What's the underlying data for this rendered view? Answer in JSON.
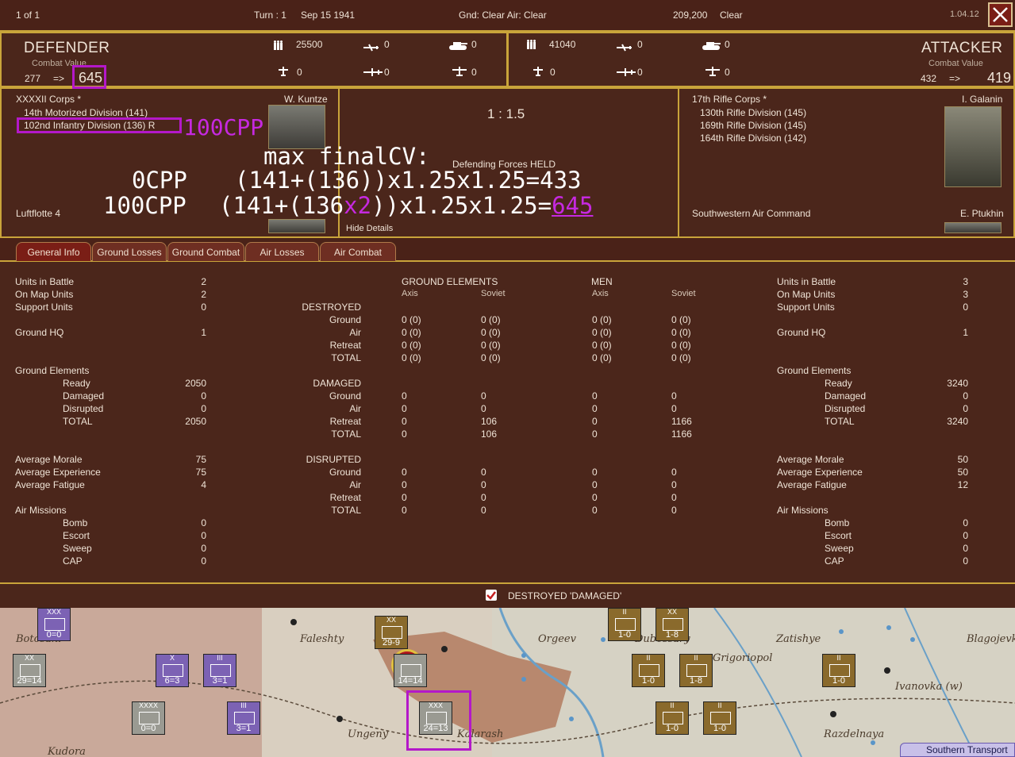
{
  "topbar": {
    "page": "1 of 1",
    "turn": "Turn : 1",
    "date": "Sep 15 1941",
    "weather": "Gnd: Clear  Air: Clear",
    "coords": "209,200",
    "terrain": "Clear",
    "version": "1.04.12",
    "close_icon": "close-x-icon"
  },
  "defender": {
    "title": "DEFENDER",
    "cv_label": "Combat Value",
    "cv_base": "277",
    "arrow": "=>",
    "cv_final": "645",
    "men": "25500",
    "fighters": "0",
    "tanks": "0",
    "bombers": "0",
    "transports": "0",
    "recon": "0",
    "corps": "XXXXII Corps *",
    "commander": "W. Kuntze",
    "units": [
      "14th Motorized Division (141)",
      "102nd Infantry Division (136)  R"
    ],
    "air": "Luftflotte 4"
  },
  "attacker": {
    "title": "ATTACKER",
    "cv_label": "Combat Value",
    "cv_base": "432",
    "arrow": "=>",
    "cv_final": "419",
    "men": "41040",
    "fighters": "0",
    "tanks": "0",
    "bombers": "0",
    "transports": "0",
    "recon": "0",
    "corps": "17th Rifle Corps *",
    "commander": "I. Galanin",
    "units": [
      "130th Rifle Division (145)",
      "169th Rifle Division (145)",
      "164th Rifle Division (142)"
    ],
    "air": "Southwestern Air Command",
    "air_commander": "E. Ptukhin"
  },
  "center": {
    "odds": "1 : 1.5",
    "result": "Defending Forces HELD",
    "hide": "Hide Details"
  },
  "overlay": {
    "cpp_label": "100CPP",
    "max_title": "max finalCV:",
    "row1_label": "0CPP",
    "row1_formula": "(141+(136))x1.25x1.25=433",
    "row2_label": "100CPP",
    "row2_a": "(141+(",
    "row2_b": "136",
    "row2_c": "x2",
    "row2_d": "))x1.25x1.25=",
    "row2_e": "645"
  },
  "tabs": [
    "General Info",
    "Ground Losses",
    "Ground Combat",
    "Air Losses",
    "Air Combat"
  ],
  "left_stats": [
    [
      "Units in Battle",
      "2"
    ],
    [
      "On Map Units",
      "2"
    ],
    [
      "Support Units",
      "0"
    ],
    [
      "",
      ""
    ],
    [
      "Ground HQ",
      "1"
    ],
    [
      "",
      ""
    ],
    [
      "",
      ""
    ],
    [
      "Ground Elements",
      ""
    ],
    [
      "  Ready",
      "2050"
    ],
    [
      "  Damaged",
      "0"
    ],
    [
      "  Disrupted",
      "0"
    ],
    [
      "  TOTAL",
      "2050"
    ],
    [
      "",
      ""
    ],
    [
      "",
      ""
    ],
    [
      "Average Morale",
      "75"
    ],
    [
      "Average Experience",
      "75"
    ],
    [
      "Average Fatigue",
      "4"
    ],
    [
      "",
      ""
    ],
    [
      "Air Missions",
      ""
    ],
    [
      "  Bomb",
      "0"
    ],
    [
      "  Escort",
      "0"
    ],
    [
      "  Sweep",
      "0"
    ],
    [
      "  CAP",
      "0"
    ]
  ],
  "right_stats": [
    [
      "Units in Battle",
      "3"
    ],
    [
      "On Map Units",
      "3"
    ],
    [
      "Support Units",
      "0"
    ],
    [
      "",
      ""
    ],
    [
      "Ground HQ",
      "1"
    ],
    [
      "",
      ""
    ],
    [
      "",
      ""
    ],
    [
      "Ground Elements",
      ""
    ],
    [
      "  Ready",
      "3240"
    ],
    [
      "  Damaged",
      "0"
    ],
    [
      "  Disrupted",
      "0"
    ],
    [
      "  TOTAL",
      "3240"
    ],
    [
      "",
      ""
    ],
    [
      "",
      ""
    ],
    [
      "Average Morale",
      "50"
    ],
    [
      "Average Experience",
      "50"
    ],
    [
      "Average Fatigue",
      "12"
    ],
    [
      "",
      ""
    ],
    [
      "Air Missions",
      ""
    ],
    [
      "  Bomb",
      "0"
    ],
    [
      "  Escort",
      "0"
    ],
    [
      "  Sweep",
      "0"
    ],
    [
      "  CAP",
      "0"
    ]
  ],
  "losses": {
    "hdr_ge": "GROUND ELEMENTS",
    "hdr_men": "MEN",
    "axis": "Axis",
    "soviet": "Soviet",
    "rows": [
      [
        "DESTROYED",
        "",
        "",
        "",
        "",
        ""
      ],
      [
        "Ground",
        "0  (0)",
        "0  (0)",
        "0  (0)",
        "0  (0)",
        ""
      ],
      [
        "Air",
        "0  (0)",
        "0  (0)",
        "0  (0)",
        "0  (0)",
        ""
      ],
      [
        "Retreat",
        "0  (0)",
        "0  (0)",
        "0  (0)",
        "0  (0)",
        ""
      ],
      [
        "TOTAL",
        "0  (0)",
        "0  (0)",
        "0  (0)",
        "0  (0)",
        ""
      ],
      [
        "",
        "",
        "",
        "",
        "",
        ""
      ],
      [
        "DAMAGED",
        "",
        "",
        "",
        "",
        ""
      ],
      [
        "Ground",
        "0",
        "0",
        "0",
        "0",
        ""
      ],
      [
        "Air",
        "0",
        "0",
        "0",
        "0",
        ""
      ],
      [
        "Retreat",
        "0",
        "106",
        "0",
        "1166",
        ""
      ],
      [
        "TOTAL",
        "0",
        "106",
        "0",
        "1166",
        ""
      ],
      [
        "",
        "",
        "",
        "",
        "",
        ""
      ],
      [
        "DISRUPTED",
        "",
        "",
        "",
        "",
        ""
      ],
      [
        "Ground",
        "0",
        "0",
        "0",
        "0",
        ""
      ],
      [
        "Air",
        "0",
        "0",
        "0",
        "0",
        ""
      ],
      [
        "Retreat",
        "0",
        "0",
        "0",
        "0",
        ""
      ],
      [
        "TOTAL",
        "0",
        "0",
        "0",
        "0",
        ""
      ]
    ]
  },
  "footer": {
    "checkbox_label": "DESTROYED 'DAMAGED'",
    "checked": true
  },
  "map": {
    "places": [
      "Botosani",
      "Faleshty",
      "Orgeev",
      "Zatishye",
      "Blagojevka",
      "Grigoriopol",
      "Ivanovka (w)",
      "Ungeny",
      "Kalarash",
      "Razdelnaya",
      "Dubossary",
      "Kudora"
    ],
    "transport_btn": "Southern Transport",
    "units": [
      {
        "top": "XXX",
        "lbl": "0=0",
        "color": "#7c62b4"
      },
      {
        "top": "XX",
        "lbl": "29=14",
        "color": "#9a9a92"
      },
      {
        "top": "X",
        "lbl": "6=3",
        "color": "#7c62b4"
      },
      {
        "top": "III",
        "lbl": "3=1",
        "color": "#7c62b4"
      },
      {
        "top": "XXXX",
        "lbl": "0=0",
        "color": "#9a9a92"
      },
      {
        "top": "III",
        "lbl": "3=1",
        "color": "#7c62b4"
      },
      {
        "top": "XX",
        "lbl": "29-9",
        "color": "#8a6a2c"
      },
      {
        "top": "",
        "lbl": "14=14",
        "color": "#9a9a92"
      },
      {
        "top": "XXX",
        "lbl": "24=13",
        "color": "#9a9a92"
      },
      {
        "top": "II",
        "lbl": "1-0",
        "color": "#8a6a2c"
      },
      {
        "top": "XX",
        "lbl": "1-8",
        "color": "#8a6a2c"
      },
      {
        "top": "II",
        "lbl": "1-0",
        "color": "#8a6a2c"
      },
      {
        "top": "II",
        "lbl": "1-8",
        "color": "#8a6a2c"
      },
      {
        "top": "II",
        "lbl": "1-0",
        "color": "#8a6a2c"
      },
      {
        "top": "II",
        "lbl": "1-0",
        "color": "#8a6a2c"
      },
      {
        "top": "II",
        "lbl": "1-0",
        "color": "#8a6a2c"
      }
    ]
  }
}
